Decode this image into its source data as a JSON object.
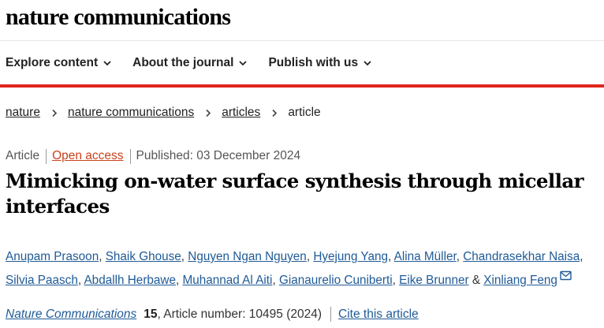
{
  "header": {
    "logo_text": "nature communications"
  },
  "nav": {
    "items": [
      {
        "label": "Explore content",
        "icon": "chevron-down-icon"
      },
      {
        "label": "About the journal",
        "icon": "chevron-down-icon"
      },
      {
        "label": "Publish with us",
        "icon": "chevron-down-icon"
      }
    ]
  },
  "accent_color": "#e0261d",
  "breadcrumb": {
    "items": [
      "nature",
      "nature communications",
      "articles"
    ],
    "current": "article",
    "separator_icon": "chevron-right-icon"
  },
  "article": {
    "type": "Article",
    "access": "Open access",
    "published": "Published: 03 December 2024",
    "title": "Mimicking on-water surface synthesis through micellar interfaces",
    "authors": [
      "Anupam Prasoon",
      "Shaik Ghouse",
      "Nguyen Ngan Nguyen",
      "Hyejung Yang",
      "Alina Müller",
      "Chandrasekhar Naisa",
      "Silvia Paasch",
      "Abdallh Herbawe",
      "Muhannad Al Aiti",
      "Gianaurelio Cuniberti",
      "Eike Brunner",
      "Xinliang Feng"
    ],
    "author_separator": ",",
    "last_author_joiner": "&",
    "corresponding_icon": "mail-icon",
    "citation": {
      "journal": "Nature Communications",
      "volume": "15",
      "article_number": ", Article number: 10495 (2024)",
      "cite_label": "Cite this article"
    }
  }
}
